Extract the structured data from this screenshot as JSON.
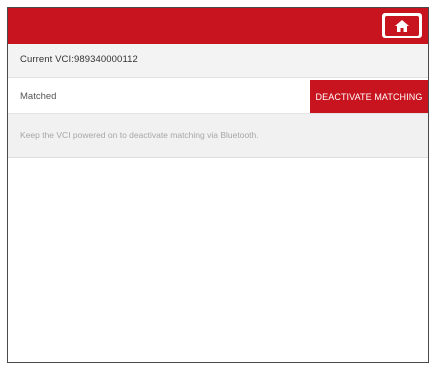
{
  "header": {
    "home_icon": "home-icon"
  },
  "vci": {
    "label": "Current VCI:989340000112"
  },
  "status": {
    "text": "Matched",
    "button_label": "DEACTIVATE MATCHING"
  },
  "hint": {
    "text": "Keep the VCI powered on to deactivate matching via Bluetooth."
  },
  "colors": {
    "accent": "#c8141e"
  }
}
